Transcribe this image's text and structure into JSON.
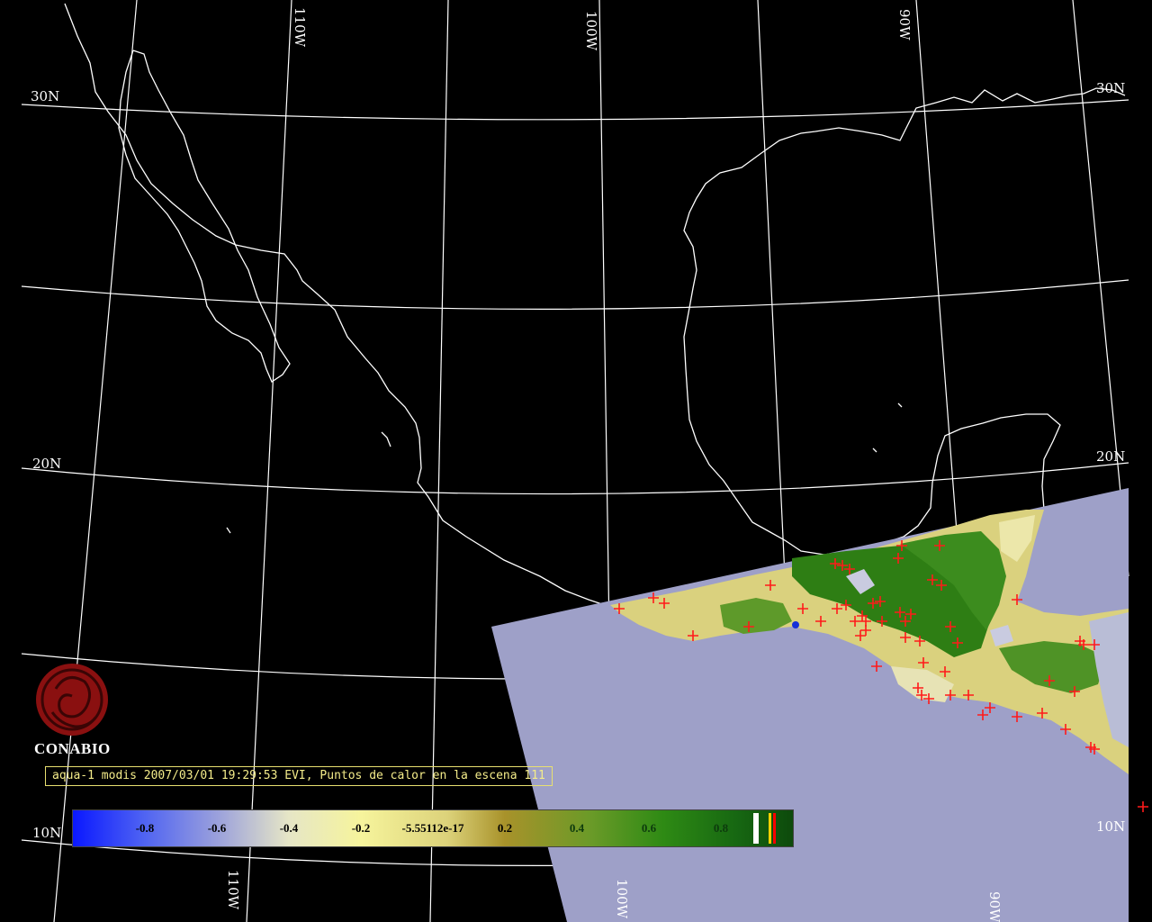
{
  "map": {
    "longitude_labels": [
      "110W",
      "100W",
      "90W",
      "110W",
      "100W",
      "90W"
    ],
    "latitude_labels": [
      "30N",
      "30N",
      "20N",
      "20N",
      "10N",
      "10N"
    ]
  },
  "logo": {
    "name": "CONABIO"
  },
  "caption": {
    "text": "aqua-1 modis 2007/03/01 19:29:53 EVI, Puntos de calor en la escena 111"
  },
  "colorbar": {
    "ticks": [
      "-0.8",
      "-0.6",
      "-0.4",
      "-0.2",
      "-5.55112e-17",
      "0.2",
      "0.4",
      "0.6",
      "0.8"
    ],
    "stripe_colors": [
      "#ffffff",
      "#ffd200",
      "#ff0000"
    ]
  },
  "colors": {
    "background": "#000000",
    "graticule": "#ffffff",
    "no_data": "#9ea0c8",
    "hotspot": "#ff1a1a",
    "caption": "#f4ec8a"
  }
}
